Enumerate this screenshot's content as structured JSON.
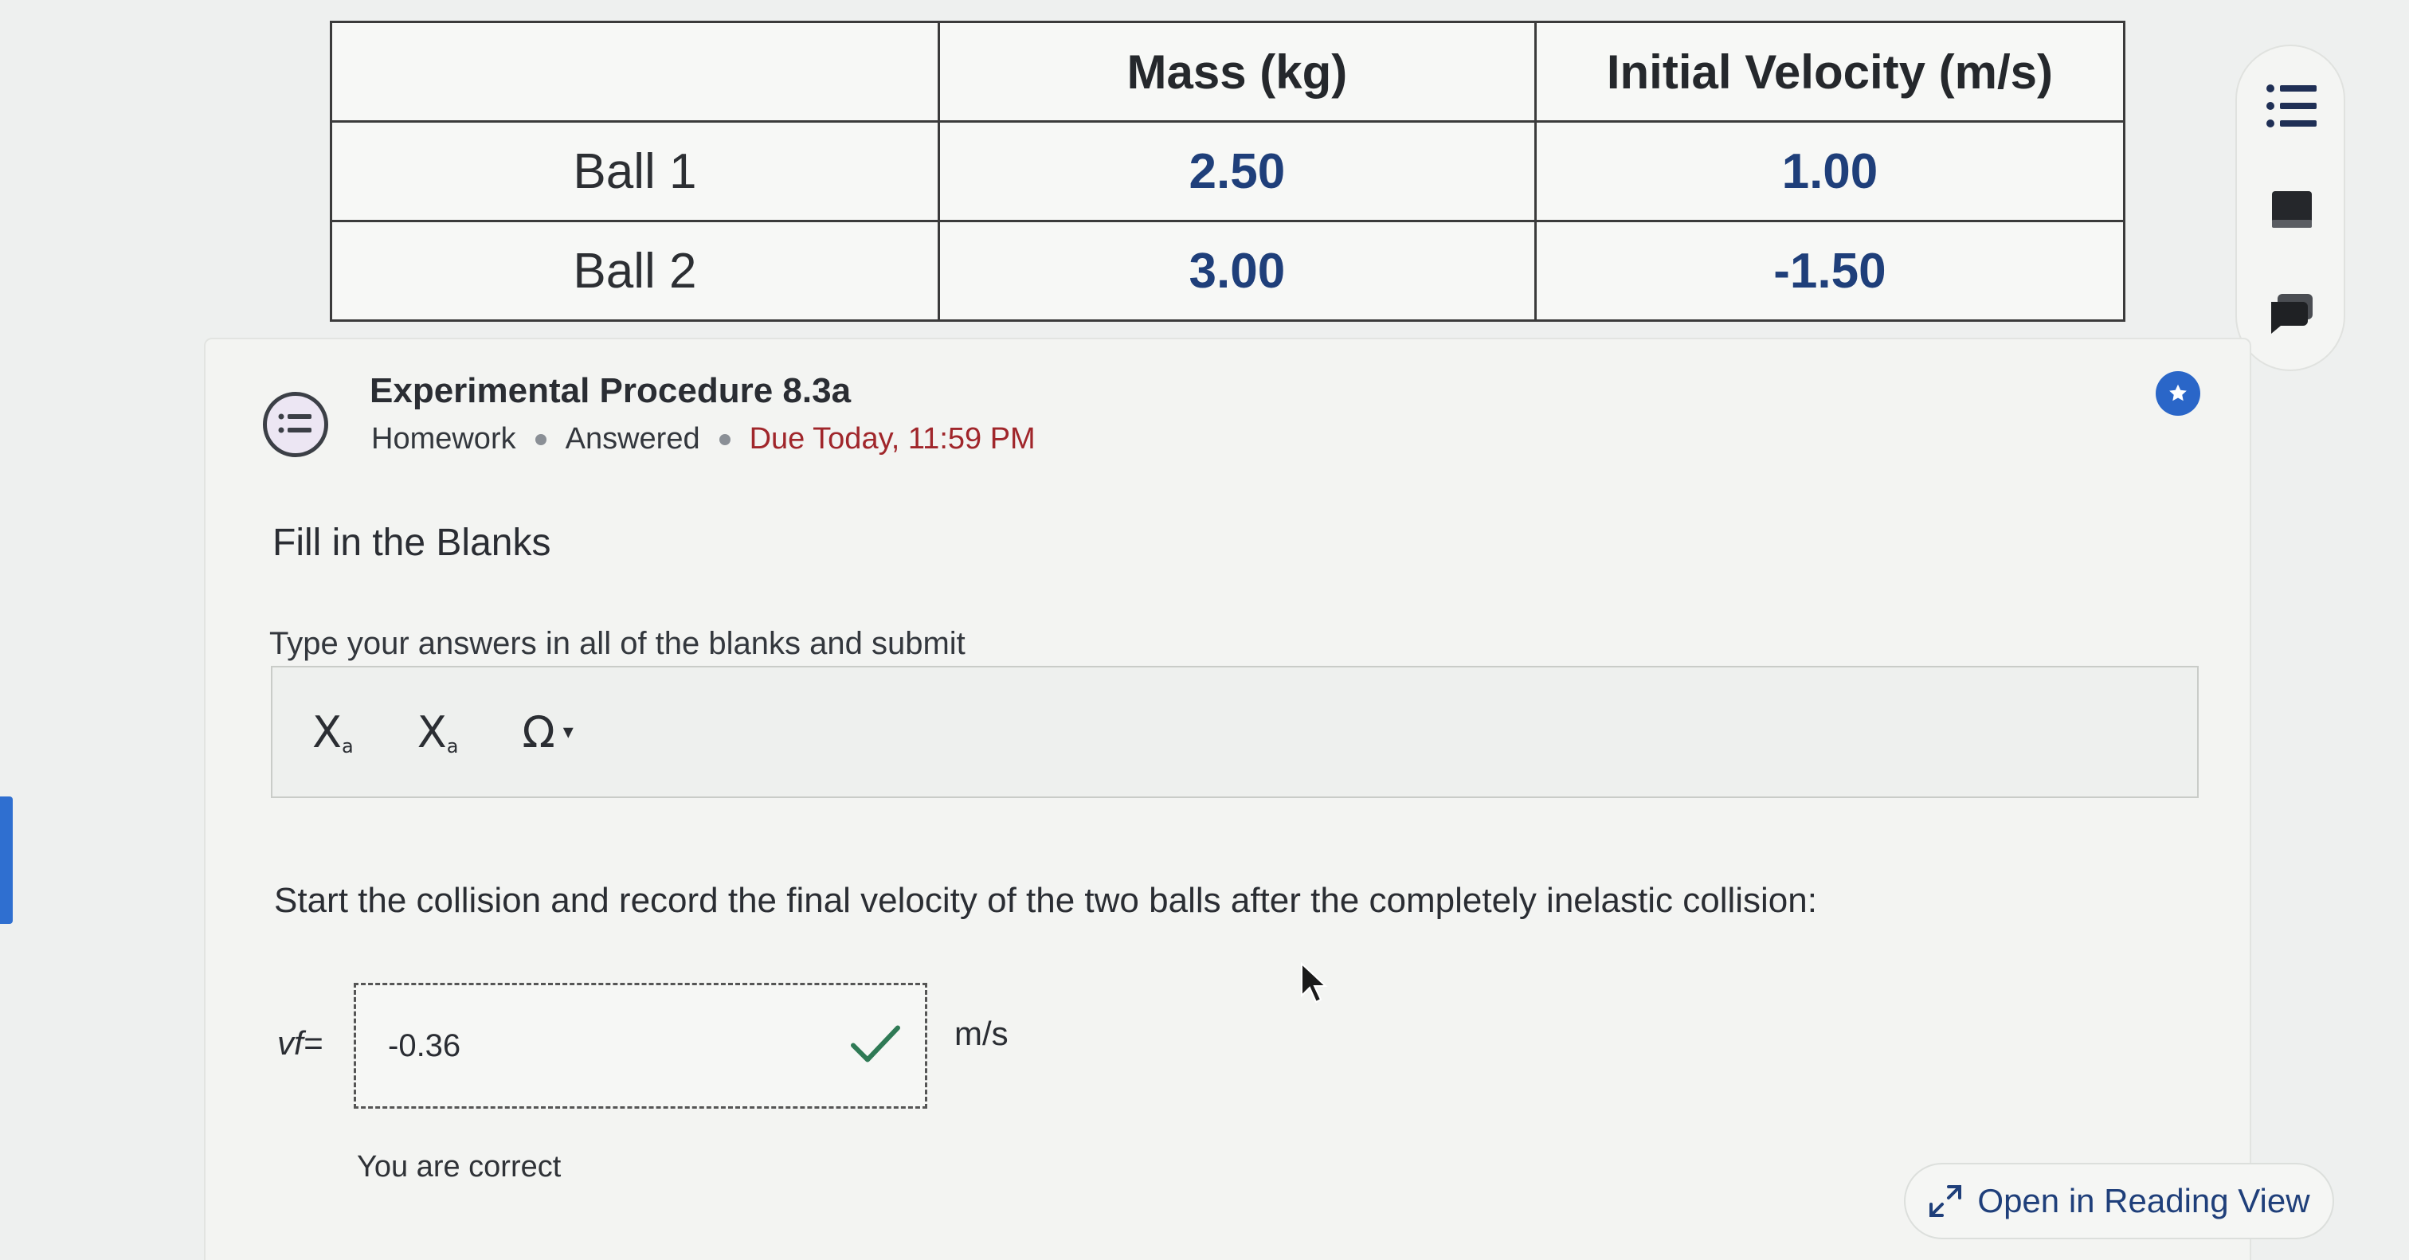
{
  "table": {
    "headers": [
      "",
      "Mass (kg)",
      "Initial Velocity (m/s)"
    ],
    "rows": [
      {
        "label": "Ball 1",
        "mass": "2.50",
        "velocity": "1.00"
      },
      {
        "label": "Ball 2",
        "mass": "3.00",
        "velocity": "-1.50"
      }
    ]
  },
  "assignment": {
    "title": "Experimental Procedure 8.3a",
    "type": "Homework",
    "status": "Answered",
    "due": "Due Today, 11:59 PM"
  },
  "section": {
    "title": "Fill in the Blanks",
    "instructions": "Type your answers in all of the blanks and submit"
  },
  "toolbar": {
    "subscript_label": "X",
    "subscript_mark": "a",
    "superscript_label": "X",
    "superscript_mark": "a",
    "symbol_label": "Ω"
  },
  "question": {
    "text": "Start the collision and record the final velocity of the two balls after the completely inelastic collision:",
    "answer_label": "vf=",
    "answer_value": "-0.36",
    "unit": "m/s",
    "feedback": "You are correct"
  },
  "reading_view": {
    "label": "Open in Reading View"
  },
  "colors": {
    "accent": "#2a66c8",
    "due": "#a0262b",
    "correct": "#2f7a55"
  },
  "icons": {
    "rail": [
      "list-icon",
      "note-icon",
      "chat-icon"
    ],
    "badge": "discussion-list-icon",
    "bookmark": "star-badge-icon",
    "check": "checkmark-icon",
    "expand": "expand-arrows-icon"
  }
}
